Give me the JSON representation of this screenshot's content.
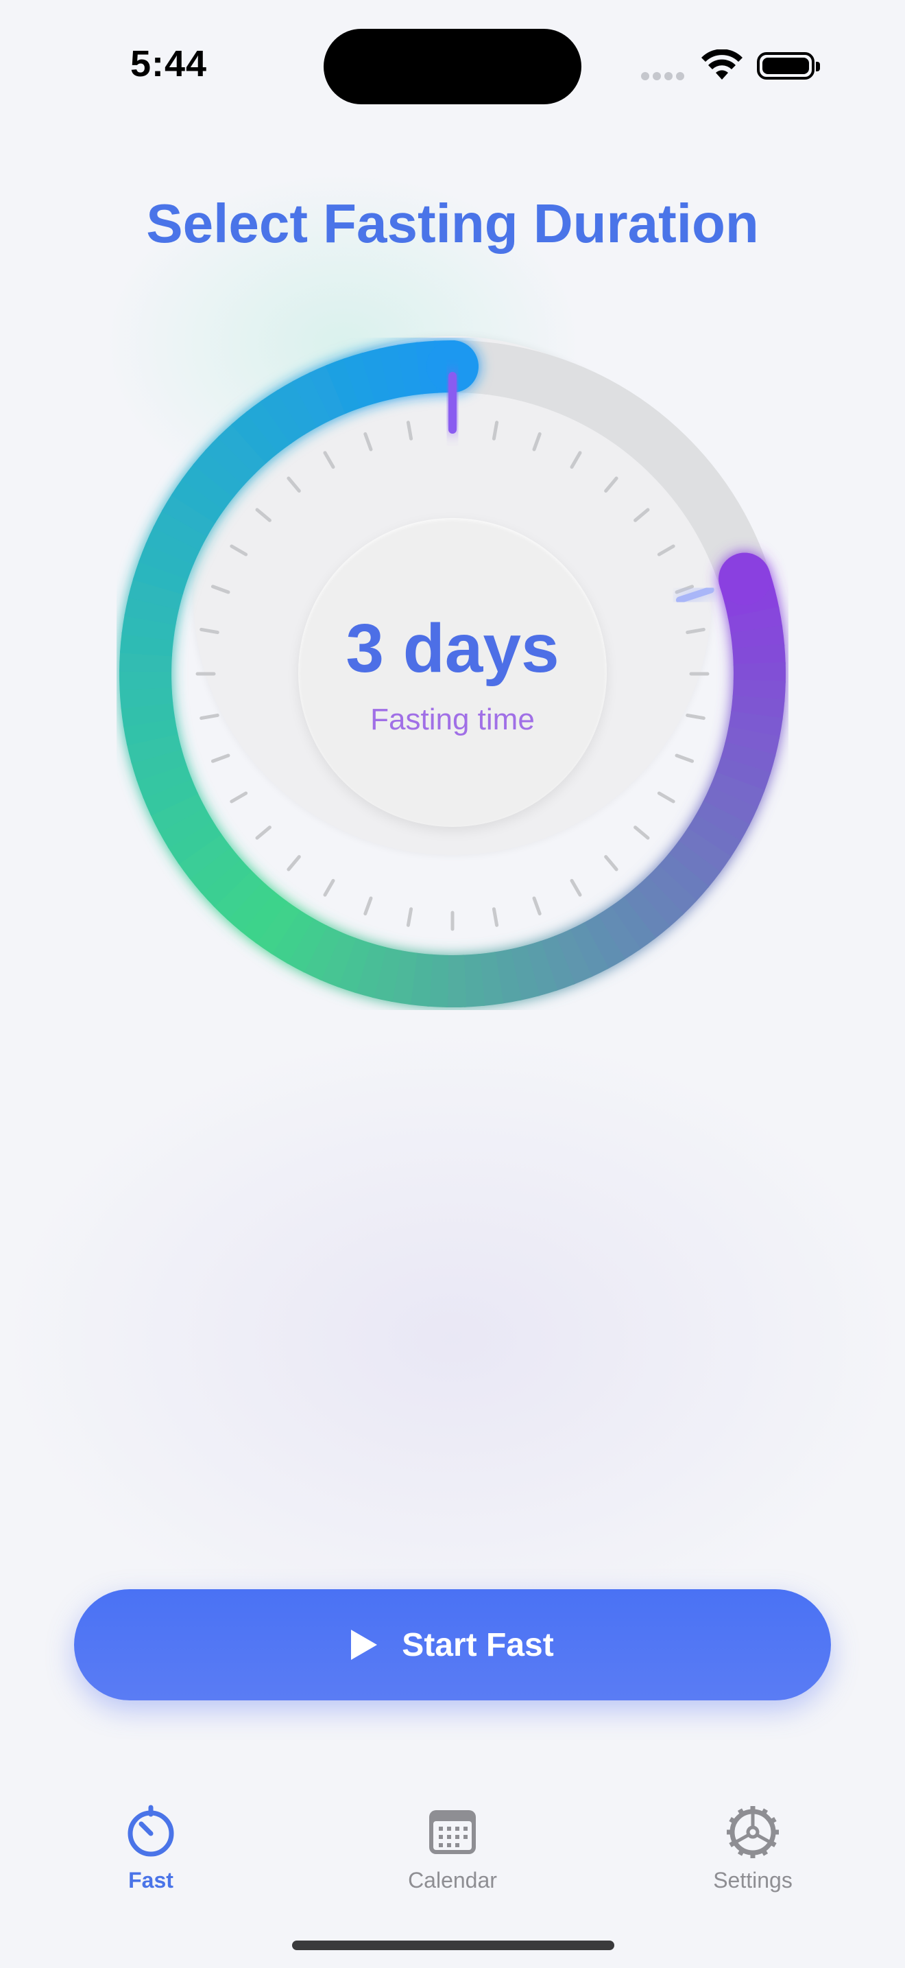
{
  "status_bar": {
    "time": "5:44"
  },
  "header": {
    "title": "Select Fasting Duration"
  },
  "dial": {
    "value": "3 days",
    "label": "Fasting time",
    "selected_fraction": 0.8
  },
  "actions": {
    "start_label": "Start Fast"
  },
  "tab_bar": {
    "items": [
      {
        "label": "Fast",
        "icon": "timer-icon",
        "active": true
      },
      {
        "label": "Calendar",
        "icon": "calendar-icon",
        "active": false
      },
      {
        "label": "Settings",
        "icon": "gear-icon",
        "active": false
      }
    ]
  },
  "colors": {
    "accent": "#4a74e8",
    "label_purple": "#a06fe6",
    "ring_start": "#8a3fe0",
    "ring_mid": "#3ed48a",
    "ring_end": "#1a98f0"
  }
}
